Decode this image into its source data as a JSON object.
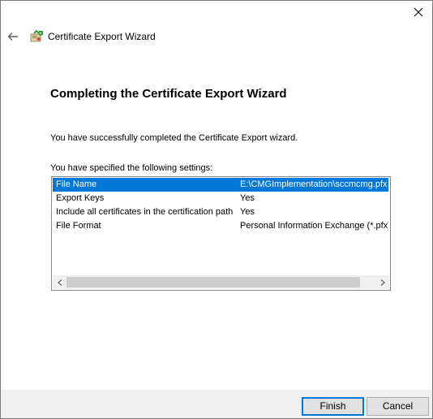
{
  "window": {
    "title": "Certificate Export Wizard"
  },
  "icons": {
    "close": "close-icon",
    "back": "back-arrow-icon",
    "app": "certificate-icon",
    "scroll_left": "chevron-left-icon",
    "scroll_right": "chevron-right-icon"
  },
  "page": {
    "heading": "Completing the Certificate Export Wizard",
    "success_text": "You have successfully completed the Certificate Export wizard.",
    "settings_label": "You have specified the following settings:"
  },
  "settings": {
    "rows": [
      {
        "name": "File Name",
        "value": "E:\\CMGImplementation\\sccmcmg.pfx",
        "selected": true
      },
      {
        "name": "Export Keys",
        "value": "Yes",
        "selected": false
      },
      {
        "name": "Include all certificates in the certification path",
        "value": "Yes",
        "selected": false
      },
      {
        "name": "File Format",
        "value": "Personal Information Exchange (*.pfx)",
        "selected": false
      }
    ]
  },
  "buttons": {
    "finish": "Finish",
    "cancel": "Cancel"
  },
  "colors": {
    "selection": "#0078d7",
    "footer": "#f0f0f0"
  }
}
